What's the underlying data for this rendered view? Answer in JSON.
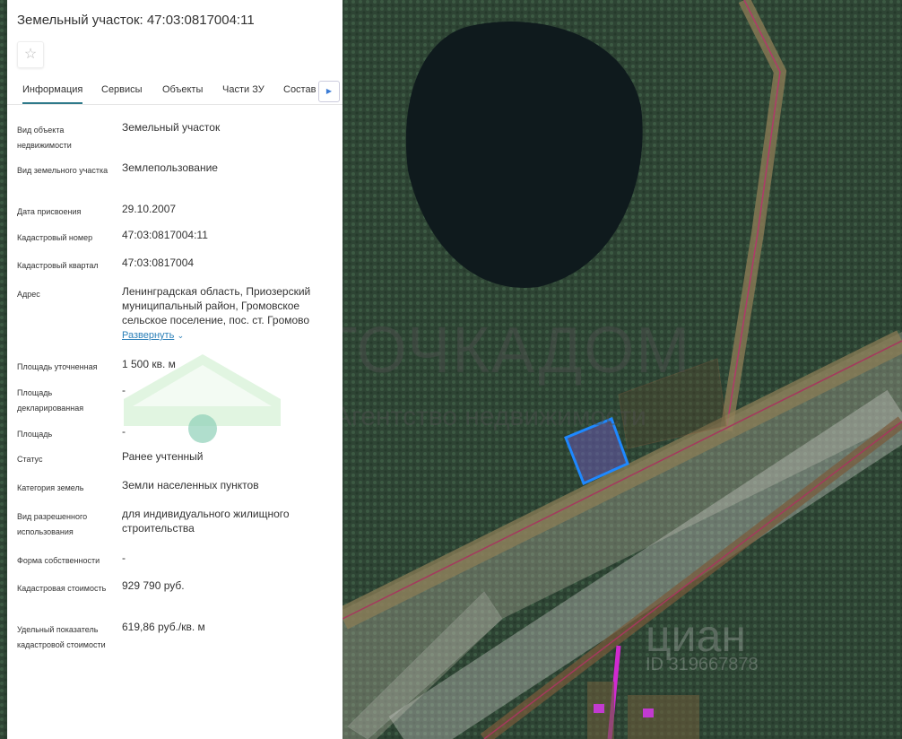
{
  "panel": {
    "title": "Земельный участок: 47:03:0817004:11",
    "star_icon": "star-outline-icon",
    "tabs": [
      "Информация",
      "Сервисы",
      "Объекты",
      "Части ЗУ",
      "Состав"
    ],
    "rows": [
      {
        "label": "Вид объекта недвижимости",
        "value": "Земельный участок"
      },
      {
        "label": "Вид земельного участка",
        "value": "Землепользование"
      },
      {
        "label": "Дата присвоения",
        "value": "29.10.2007"
      },
      {
        "label": "Кадастровый номер",
        "value": "47:03:0817004:11"
      },
      {
        "label": "Кадастровый квартал",
        "value": "47:03:0817004"
      },
      {
        "label": "Адрес",
        "value": "Ленинградская область, Приозерский муниципальный район, Громовское сельское поселение, пос. ст. Громово"
      },
      {
        "label": "Площадь уточненная",
        "value": "1 500 кв. м"
      },
      {
        "label": "Площадь декларированная",
        "value": "-"
      },
      {
        "label": "Площадь",
        "value": "-"
      },
      {
        "label": "Статус",
        "value": "Ранее учтенный"
      },
      {
        "label": "Категория земель",
        "value": "Земли населенных пунктов"
      },
      {
        "label": "Вид разрешенного использования",
        "value": "для индивидуального жилищного строительства"
      },
      {
        "label": "Форма собственности",
        "value": "-"
      },
      {
        "label": "Кадастровая стоимость",
        "value": "929 790 руб."
      },
      {
        "label": "Удельный показатель кадастровой стоимости",
        "value": "619,86 руб./кв. м"
      }
    ],
    "expand_label": "Развернуть"
  },
  "watermarks": {
    "brand": "ТОЧКАДОМ",
    "brand_sub": "Агентство недвижимости",
    "cian": "циан",
    "cian_id": "ID 319667878"
  },
  "colors": {
    "parcel": "#1e88ff",
    "tab_accent": "#2f7a8a"
  }
}
